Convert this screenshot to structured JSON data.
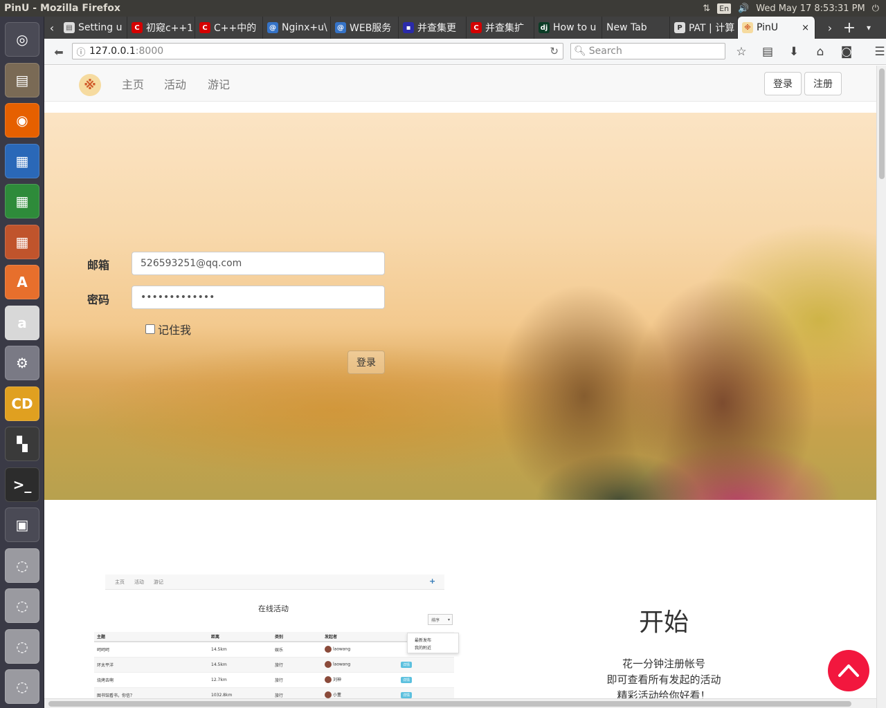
{
  "os": {
    "window_title": "PinU - Mozilla Firefox",
    "lang": "En",
    "clock": "Wed May 17  8:53:31 PM"
  },
  "launcher": [
    {
      "name": "ubuntu-dash-icon",
      "color": "#4a4a55",
      "glyph": "◎"
    },
    {
      "name": "files-icon",
      "color": "#7a6a55",
      "glyph": "▤"
    },
    {
      "name": "firefox-icon",
      "color": "#e66000",
      "glyph": "◉"
    },
    {
      "name": "writer-icon",
      "color": "#2a68b8",
      "glyph": "▦"
    },
    {
      "name": "calc-icon",
      "color": "#2e8b3a",
      "glyph": "▦"
    },
    {
      "name": "impress-icon",
      "color": "#c0542c",
      "glyph": "▦"
    },
    {
      "name": "software-center-icon",
      "color": "#e76f2c",
      "glyph": "A"
    },
    {
      "name": "amazon-icon",
      "color": "#d8d8d8",
      "glyph": "a"
    },
    {
      "name": "system-settings-icon",
      "color": "#7a7a85",
      "glyph": "⚙"
    },
    {
      "name": "cd-icon",
      "color": "#e0a020",
      "glyph": "CD"
    },
    {
      "name": "workspaces-icon",
      "color": "#3a3a3a",
      "glyph": "▚"
    },
    {
      "name": "terminal-icon",
      "color": "#2c2c2c",
      "glyph": ">_"
    },
    {
      "name": "workspace-switcher-icon",
      "color": "#4a4a55",
      "glyph": "▣"
    },
    {
      "name": "drive-icon-1",
      "color": "#9a9aa0",
      "glyph": "◌"
    },
    {
      "name": "drive-icon-2",
      "color": "#9a9aa0",
      "glyph": "◌"
    },
    {
      "name": "drive-icon-3",
      "color": "#9a9aa0",
      "glyph": "◌"
    },
    {
      "name": "trash-icon",
      "color": "#9a9aa0",
      "glyph": "◌"
    }
  ],
  "tabs": [
    {
      "label": "Setting u",
      "fav": "▤",
      "favcolor": "#555555",
      "favbg": "#dddddd"
    },
    {
      "label": "初窥c++1",
      "fav": "C",
      "favcolor": "#ffffff",
      "favbg": "#d40000"
    },
    {
      "label": "C++中的",
      "fav": "C",
      "favcolor": "#ffffff",
      "favbg": "#d40000"
    },
    {
      "label": "Nginx+u\\",
      "fav": "@",
      "favcolor": "#ffffff",
      "favbg": "#3573c7"
    },
    {
      "label": "WEB服务",
      "fav": "@",
      "favcolor": "#ffffff",
      "favbg": "#3573c7"
    },
    {
      "label": "并查集更",
      "fav": "▪",
      "favcolor": "#ffffff",
      "favbg": "#2a2aaa"
    },
    {
      "label": "并查集扩",
      "fav": "C",
      "favcolor": "#ffffff",
      "favbg": "#d40000"
    },
    {
      "label": "How to u",
      "fav": "dj",
      "favcolor": "#ffffff",
      "favbg": "#0c3c26"
    },
    {
      "label": "New Tab",
      "fav": "",
      "favcolor": "#ffffff",
      "favbg": "transparent"
    },
    {
      "label": "PAT | 计算",
      "fav": "P",
      "favcolor": "#333333",
      "favbg": "#dddddd"
    }
  ],
  "active_tab": {
    "label": "PinU",
    "close": "×"
  },
  "navbar": {
    "url_host": "127.0.0.1",
    "url_port": ":8000",
    "search_placeholder": "Search"
  },
  "site": {
    "nav": [
      "主页",
      "活动",
      "游记"
    ],
    "login_button": "登录",
    "register_button": "注册"
  },
  "form": {
    "email_label": "邮箱",
    "email_value": "526593251@qq.com",
    "password_label": "密码",
    "password_value": "•••••••••••••",
    "remember_label": "记住我",
    "submit_label": "登录"
  },
  "preview": {
    "nav": [
      "主页",
      "活动",
      "游记"
    ],
    "title": "在线活动",
    "sort_label": "排序",
    "dropdown": [
      "最新发布",
      "我的附近"
    ],
    "columns": [
      "主题",
      "距离",
      "类别",
      "发起者"
    ],
    "rows": [
      [
        "呵呵呵",
        "14.5km",
        "娱乐",
        "laowang",
        ""
      ],
      [
        "环太平洋",
        "14.5km",
        "旅行",
        "laowang",
        "详情"
      ],
      [
        "烧烤去啊",
        "12.7km",
        "旅行",
        "刘神",
        "详情"
      ],
      [
        "图书馆看书，你信？",
        "1032.8km",
        "旅行",
        "小董",
        "详情"
      ]
    ]
  },
  "start": {
    "heading": "开始",
    "line1": "花一分钟注册帐号",
    "line2": "即可查看所有发起的活动",
    "line3": "精彩活动给你好看！"
  }
}
